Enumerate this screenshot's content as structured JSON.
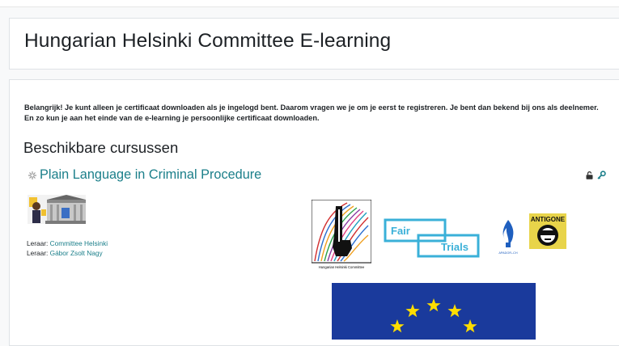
{
  "header": {
    "site_title": "Hungarian Helsinki Committee E-learning"
  },
  "notice": {
    "text": "Belangrijk! Je kunt alleen je certificaat downloaden als je ingelogd bent. Daarom vragen we je om je eerst te registreren. Je bent dan bekend bij ons als deelnemer. En zo kun je aan het einde van de e-learning je persoonlijke certificaat downloaden."
  },
  "courses_section": {
    "heading": "Beschikbare cursussen",
    "course": {
      "title": "Plain Language in Criminal Procedure",
      "icon": "course-icon",
      "status_icons": [
        "lock-open-icon",
        "key-icon"
      ],
      "teachers": [
        {
          "role": "Leraar:",
          "name": "Committee Helsinki"
        },
        {
          "role": "Leraar:",
          "name": "Gábor Zsolt Nagy"
        }
      ],
      "logos": {
        "hhc_caption": "Hungarian Helsinki Committee",
        "fair": "Fair",
        "trials": "Trials",
        "amnesty": "APADOR–CH",
        "antigone": "ANTIGONE"
      }
    }
  },
  "colors": {
    "link": "#1b7f8a",
    "background": "#f8f9fa",
    "eu_blue": "#1a3a9c",
    "eu_star": "#ffdd00",
    "fair_trials": "#3ab0d8"
  }
}
